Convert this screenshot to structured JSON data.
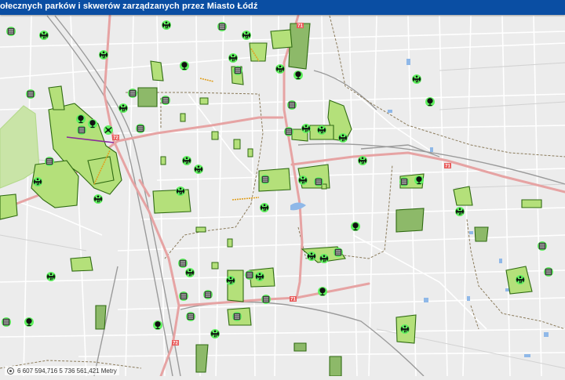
{
  "header": {
    "title": "ołecznych parków i skwerów zarządzanych przez Miasto Łódź"
  },
  "map": {
    "road_labels": [
      "71",
      "72",
      "71",
      "71",
      "72"
    ],
    "colors": {
      "background": "#ececec",
      "park_fill": "#b4e07a",
      "park_stroke": "#2f6a12",
      "major_road": "#e6a3a3",
      "street": "#ffffff",
      "railway": "#9a9a9a",
      "boundary": "#8a7a5a",
      "water": "#8fb8e8",
      "marker": "#5ff25f",
      "title_bar": "#0a4ea3"
    },
    "icon_types": [
      "fitness-equipment-icon",
      "playground-icon",
      "toilet-icon",
      "sports-court-icon"
    ]
  },
  "status": {
    "coordinates": "6 607 594,716 5 736 561,421 Metry"
  }
}
